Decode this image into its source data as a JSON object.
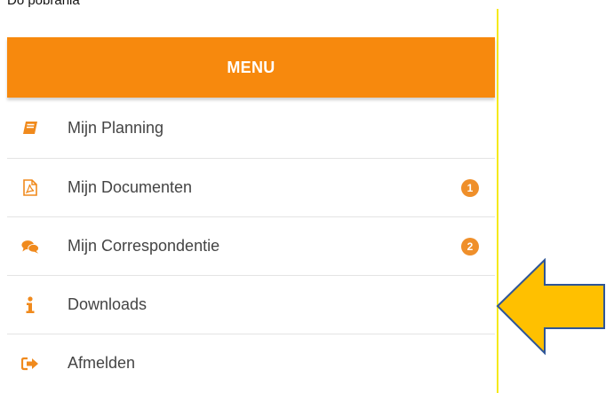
{
  "caption": "Do pobrania",
  "menu": {
    "title": "MENU",
    "items": [
      {
        "label": "Mijn Planning",
        "icon": "book-icon",
        "badge": null
      },
      {
        "label": "Mijn Documenten",
        "icon": "pdf-file-icon",
        "badge": "1"
      },
      {
        "label": "Mijn Correspondentie",
        "icon": "chat-bubbles-icon",
        "badge": "2"
      },
      {
        "label": "Downloads",
        "icon": "info-icon",
        "badge": null
      },
      {
        "label": "Afmelden",
        "icon": "sign-out-icon",
        "badge": null
      }
    ]
  },
  "colors": {
    "header": "#f7890d",
    "icon": "#f08a1d",
    "badge": "#ef8f2a",
    "arrow_fill": "#ffc000",
    "arrow_stroke": "#2e5597",
    "divider_line": "#f5ea1a"
  },
  "annotation": {
    "shape": "arrow-left",
    "points_to": "Downloads"
  }
}
